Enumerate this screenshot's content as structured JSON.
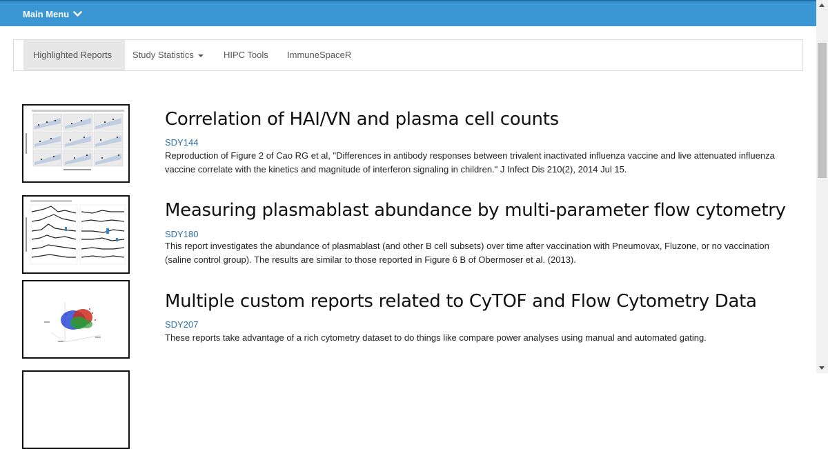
{
  "header": {
    "menu_label": "Main Menu"
  },
  "nav": {
    "tabs": [
      {
        "label": "Highlighted Reports",
        "active": true
      },
      {
        "label": "Study Statistics",
        "dropdown": true
      },
      {
        "label": "HIPC Tools"
      },
      {
        "label": "ImmuneSpaceR"
      }
    ]
  },
  "reports": [
    {
      "title": "Correlation of HAI/VN and plasma cell counts",
      "study": "SDY144",
      "description": "Reproduction of Figure 2 of Cao RG et al, \"Differences in antibody responses between trivalent inactivated influenza vaccine and live attenuated influenza vaccine correlate with the kinetics and magnitude of interferon signaling in children.\" J Infect Dis 210(2), 2014 Jul 15."
    },
    {
      "title": "Measuring plasmablast abundance by multi-parameter flow cytometry",
      "study": "SDY180",
      "description": "This report investigates the abundance of plasmablast (and other B cell subsets) over time after vaccination with Pneumovax, Fluzone, or no vaccination (saline control group). The results are similar to those reported in Figure 6 B of Obermoser et al. (2013)."
    },
    {
      "title": "Multiple custom reports related to CyTOF and Flow Cytometry Data",
      "study": "SDY207",
      "description": "These reports take advantage of a rich cytometry dataset to do things like compare power analyses using manual and automated gating."
    }
  ],
  "colors": {
    "topbar": "#3a97d4",
    "link": "#2a6fa8",
    "tab_active_bg": "#e7e7e7"
  }
}
